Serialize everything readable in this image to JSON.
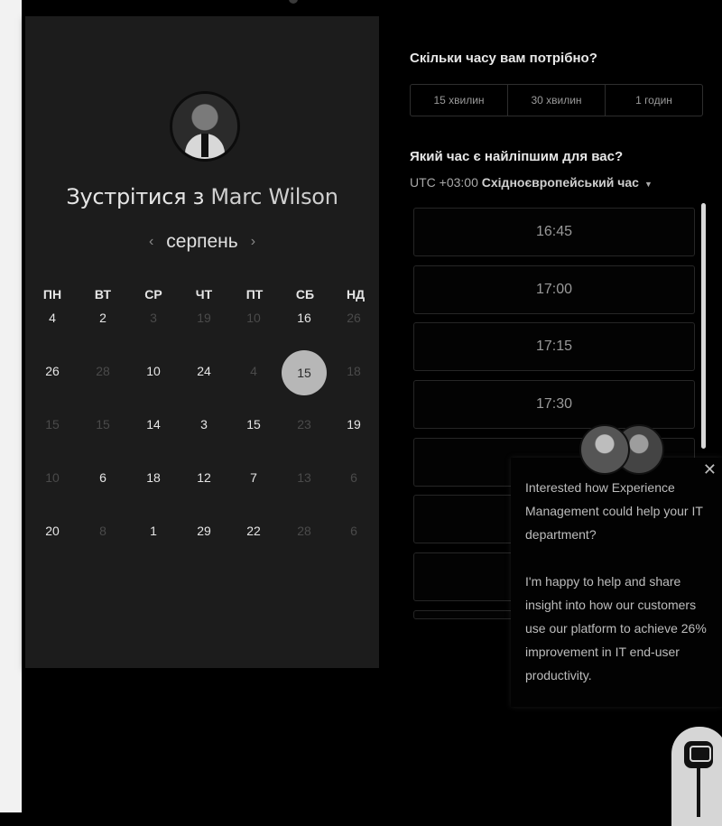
{
  "calendar": {
    "title_prefix": "Зустрітися з",
    "host_name": "Marc Wilson",
    "month": "серпень",
    "prev_arrow": "‹",
    "next_arrow": "›",
    "weekdays": [
      "ПН",
      "ВТ",
      "СР",
      "ЧТ",
      "ПТ",
      "СБ",
      "НД"
    ],
    "weeks": [
      [
        {
          "d": "4",
          "a": true
        },
        {
          "d": "2",
          "a": true
        },
        {
          "d": "3",
          "a": false
        },
        {
          "d": "19",
          "a": false
        },
        {
          "d": "10",
          "a": false
        },
        {
          "d": "16",
          "a": true
        },
        {
          "d": "26",
          "a": false
        }
      ],
      [
        {
          "d": "26",
          "a": true
        },
        {
          "d": "28",
          "a": false
        },
        {
          "d": "10",
          "a": true
        },
        {
          "d": "24",
          "a": true
        },
        {
          "d": "4",
          "a": false
        },
        {
          "d": "15",
          "a": true,
          "selected": true
        },
        {
          "d": "18",
          "a": false
        }
      ],
      [
        {
          "d": "15",
          "a": false
        },
        {
          "d": "15",
          "a": false
        },
        {
          "d": "14",
          "a": true
        },
        {
          "d": "3",
          "a": true
        },
        {
          "d": "15",
          "a": true
        },
        {
          "d": "23",
          "a": false
        },
        {
          "d": "19",
          "a": true
        }
      ],
      [
        {
          "d": "10",
          "a": false
        },
        {
          "d": "6",
          "a": true
        },
        {
          "d": "18",
          "a": true
        },
        {
          "d": "12",
          "a": true
        },
        {
          "d": "7",
          "a": true
        },
        {
          "d": "13",
          "a": false
        },
        {
          "d": "6",
          "a": false
        }
      ],
      [
        {
          "d": "20",
          "a": true
        },
        {
          "d": "8",
          "a": false
        },
        {
          "d": "1",
          "a": true
        },
        {
          "d": "29",
          "a": true
        },
        {
          "d": "22",
          "a": true
        },
        {
          "d": "28",
          "a": false
        },
        {
          "d": "6",
          "a": false
        }
      ]
    ]
  },
  "booking": {
    "duration_question": "Скільки часу вам потрібно?",
    "durations": [
      "15 хвилин",
      "30 хвилин",
      "1 годин"
    ],
    "time_question": "Який час є найліпшим для вас?",
    "tz_offset": "UTC +03:00",
    "tz_name": "Східноєвропейський час",
    "slots": [
      "16:45",
      "17:00",
      "17:15",
      "17:30",
      "",
      "",
      "",
      ""
    ]
  },
  "chat": {
    "close": "✕",
    "paragraphs": [
      "Interested how Experience Management could help your IT department?",
      "I'm happy to help and share insight into how our customers use our platform to achieve 26% improvement in IT end-user productivity."
    ]
  },
  "colors": {
    "panel_bg": "#1c1c1c",
    "selected_day": "#b7b7b7",
    "text_active": "#e6e6e6",
    "text_inactive": "#4a4a4a"
  }
}
